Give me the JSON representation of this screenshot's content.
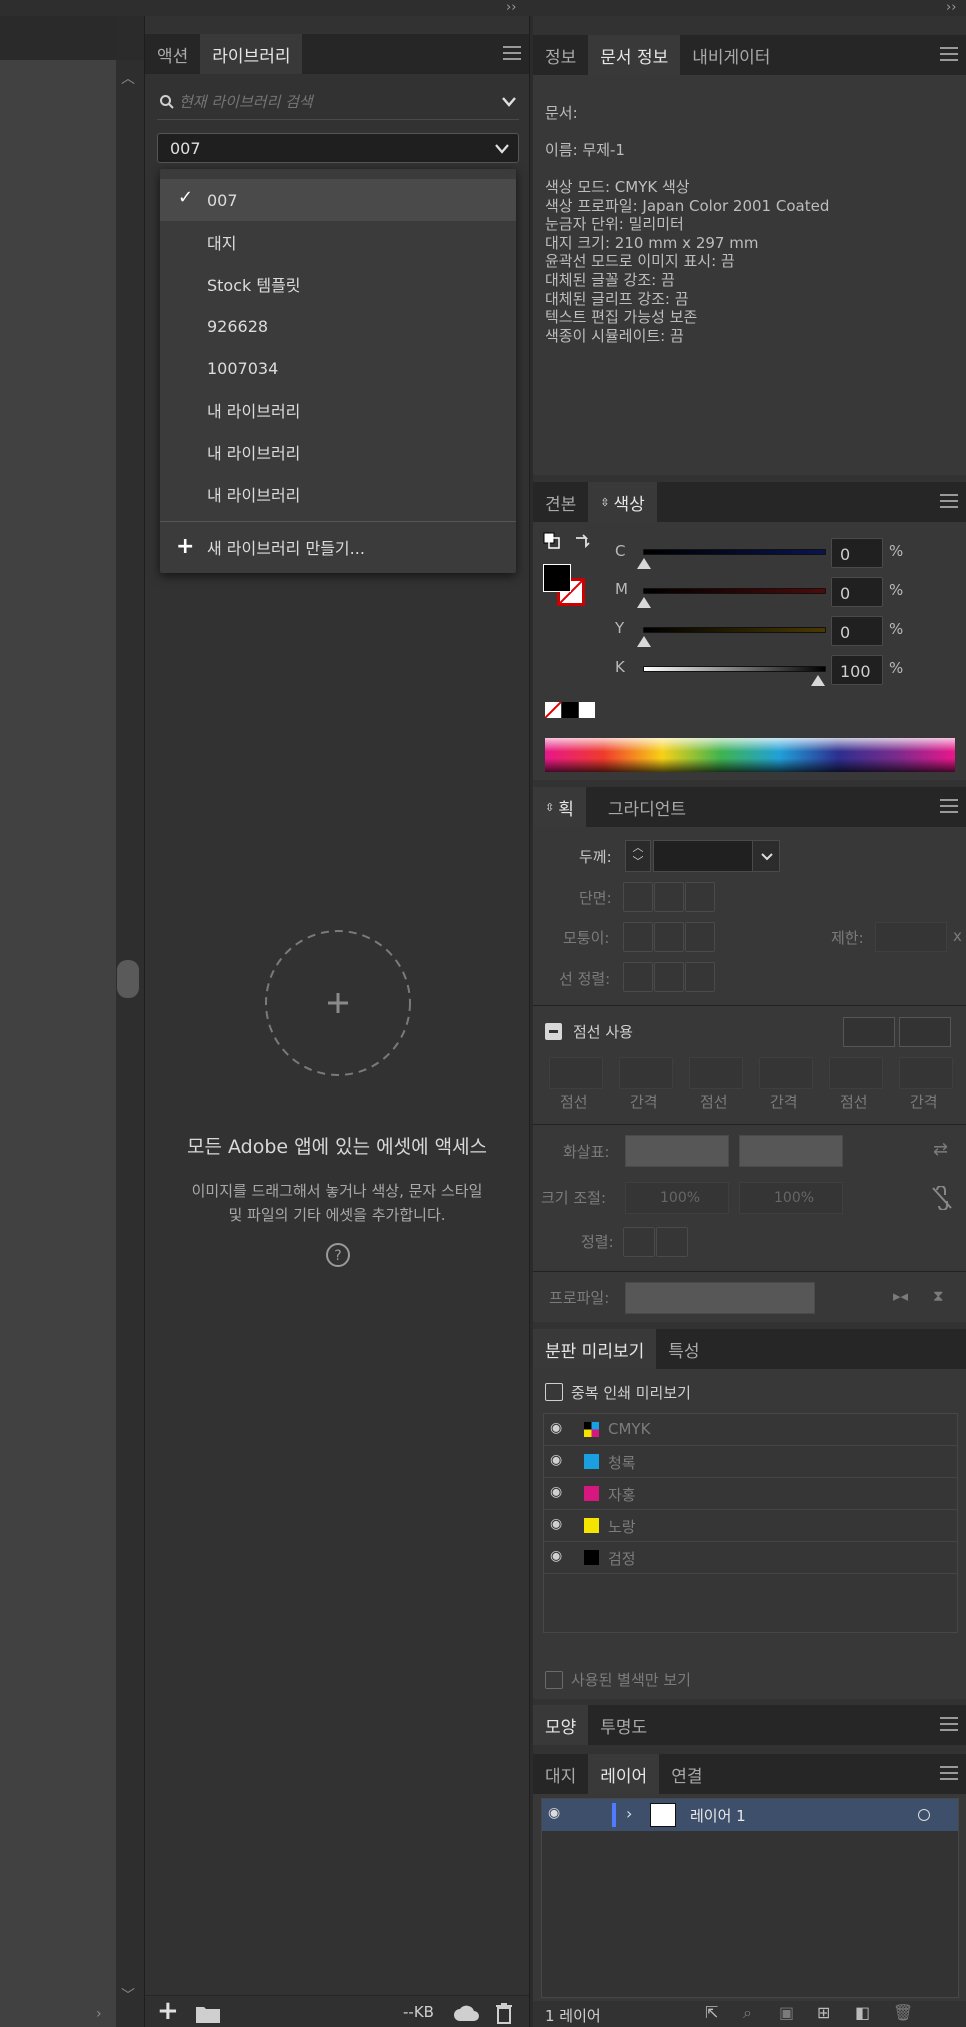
{
  "libraries_panel": {
    "tabs": [
      "액션",
      "라이브러리"
    ],
    "active_tab": "라이브러리",
    "search_placeholder": "현재 라이브러리 검색",
    "selected_library": "007",
    "dropdown": {
      "items": [
        "007",
        "대지",
        "Stock 템플릿",
        "926628",
        "1007034",
        "내 라이브러리",
        "내 라이브러리",
        "내 라이브러리"
      ],
      "checked": "007",
      "create_new": "새 라이브러리 만들기..."
    },
    "empty_title": "모든 Adobe 앱에 있는 에셋에 액세스",
    "empty_desc_line1": "이미지를 드래그해서 놓거나 색상, 문자 스타일",
    "empty_desc_line2": "및 파일의 기타 에셋을 추가합니다.",
    "footer_size": "--KB"
  },
  "doc_info_panel": {
    "tabs": [
      "정보",
      "문서 정보",
      "내비게이터"
    ],
    "active_tab": "문서 정보",
    "lines": [
      "문서:",
      "",
      "이름: 무제-1",
      "",
      "색상 모드: CMYK 색상",
      "색상 프로파일: Japan Color 2001 Coated",
      "눈금자 단위: 밀리미터",
      "대지 크기: 210 mm x 297 mm",
      "윤곽선 모드로 이미지 표시: 끔",
      "대체된 글꼴 강조: 끔",
      "대체된 글리프 강조: 끔",
      "텍스트 편집 가능성 보존",
      "색종이 시뮬레이트: 끔"
    ]
  },
  "color_panel": {
    "tabs": [
      "견본",
      "색상"
    ],
    "active_tab": "색상",
    "channels": [
      {
        "label": "C",
        "value": "0",
        "unit": "%",
        "level": 0
      },
      {
        "label": "M",
        "value": "0",
        "unit": "%",
        "level": 0
      },
      {
        "label": "Y",
        "value": "0",
        "unit": "%",
        "level": 0
      },
      {
        "label": "K",
        "value": "100",
        "unit": "%",
        "level": 1
      }
    ]
  },
  "stroke_panel": {
    "tabs": [
      "획",
      "그라디언트"
    ],
    "active_tab": "획",
    "weight_label": "두께:",
    "cap_label": "단면:",
    "corner_label": "모퉁이:",
    "limit_label": "제한:",
    "limit_unit": "x",
    "align_label": "선 정렬:",
    "dashed_label": "점선 사용",
    "dash_labels": [
      "점선",
      "간격",
      "점선",
      "간격",
      "점선",
      "간격"
    ],
    "arrowheads_label": "화살표:",
    "scale_label": "크기 조절:",
    "scale_values": [
      "100%",
      "100%"
    ],
    "align_arrow_label": "정렬:",
    "profile_label": "프로파일:"
  },
  "separations_panel": {
    "tabs": [
      "분판 미리보기",
      "특성"
    ],
    "active_tab": "분판 미리보기",
    "overprint_label": "중복 인쇄 미리보기",
    "plates": [
      {
        "name": "CMYK",
        "color": "cmyk"
      },
      {
        "name": "청록",
        "color": "#1a9fe0"
      },
      {
        "name": "자홍",
        "color": "#d6177f"
      },
      {
        "name": "노랑",
        "color": "#f5e400"
      },
      {
        "name": "검정",
        "color": "#000000"
      }
    ],
    "used_spot_label": "사용된 별색만 보기"
  },
  "appearance_panel": {
    "tabs": [
      "모양",
      "투명도"
    ],
    "active_tab": "모양"
  },
  "layers_panel": {
    "tabs": [
      "대지",
      "레이어",
      "연결"
    ],
    "active_tab": "레이어",
    "layers": [
      {
        "name": "레이어 1"
      }
    ],
    "footer_count": "1 레이어"
  }
}
